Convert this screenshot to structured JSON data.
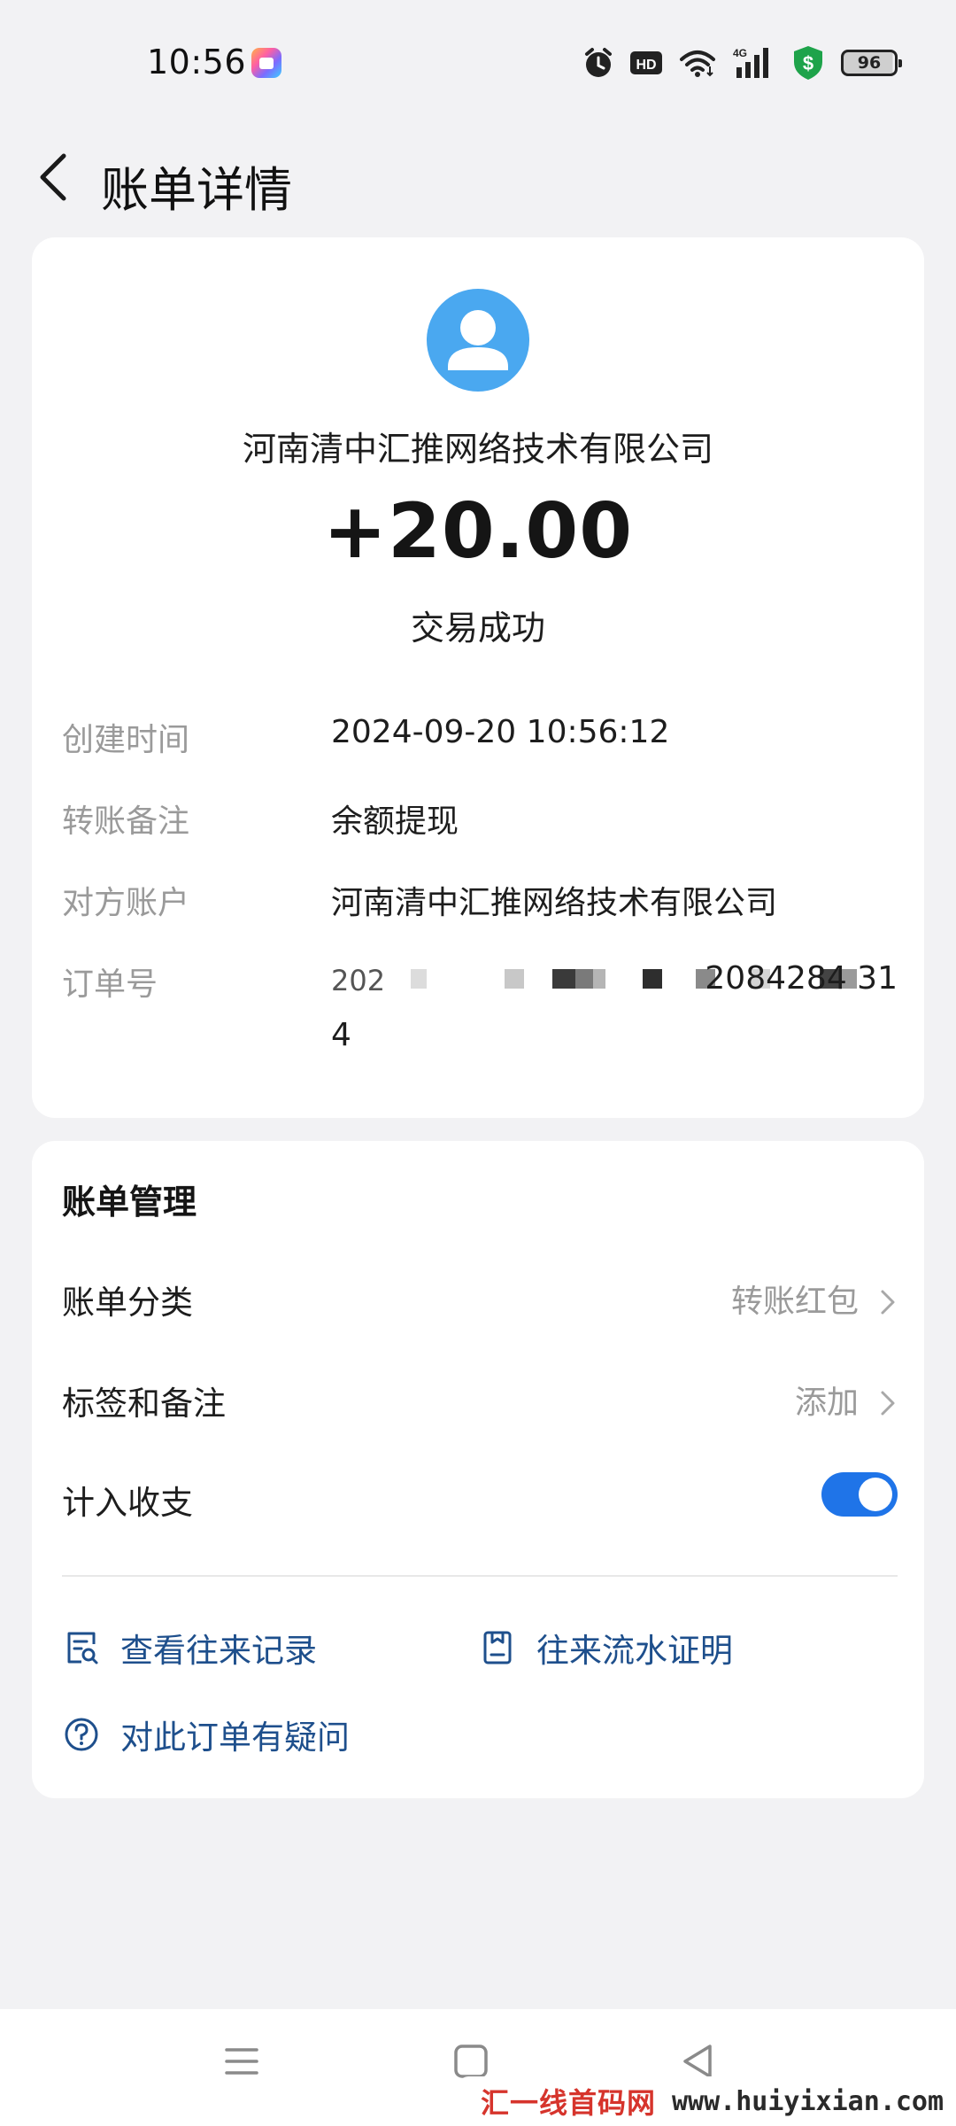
{
  "status_bar": {
    "time": "10:56",
    "battery": "96"
  },
  "header": {
    "title": "账单详情"
  },
  "transaction": {
    "payee": "河南清中汇推网络技术有限公司",
    "amount": "+20.00",
    "status": "交易成功",
    "details": [
      {
        "label": "创建时间",
        "value": "2024-09-20 10:56:12"
      },
      {
        "label": "转账备注",
        "value": "余额提现"
      },
      {
        "label": "对方账户",
        "value": "河南清中汇推网络技术有限公司"
      }
    ],
    "order": {
      "label": "订单号",
      "visible_prefix": "202",
      "visible_suffix": "2084284 31",
      "line2": "4"
    }
  },
  "bill_management": {
    "title": "账单管理",
    "category": {
      "label": "账单分类",
      "value": "转账红包"
    },
    "tags": {
      "label": "标签和备注",
      "value": "添加"
    },
    "include": {
      "label": "计入收支",
      "on": true
    },
    "links": {
      "records": "查看往来记录",
      "statement": "往来流水证明",
      "question": "对此订单有疑问"
    }
  },
  "watermark": {
    "cn": "汇一线首码网",
    "url": "www.huiyixian.com"
  },
  "colors": {
    "accent": "#1f74e8",
    "link": "#1e4f8c",
    "avatar": "#4aa8f0",
    "background": "#f2f2f4"
  }
}
